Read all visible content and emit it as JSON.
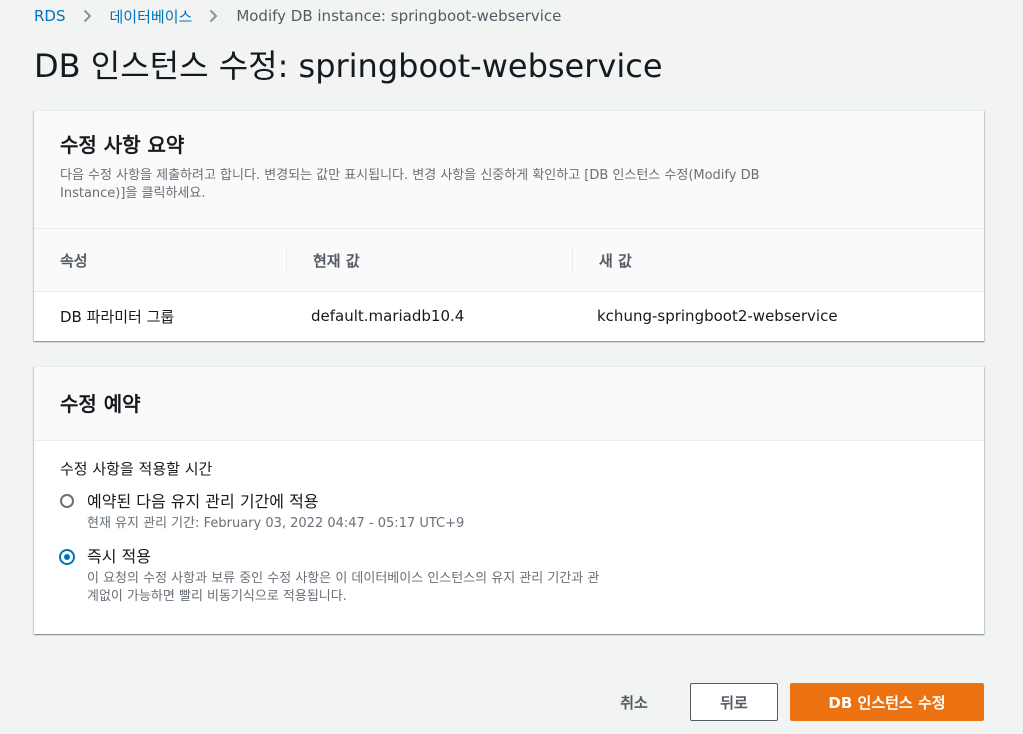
{
  "breadcrumb": {
    "items": [
      "RDS",
      "데이터베이스"
    ],
    "current": "Modify DB instance: springboot-webservice"
  },
  "page": {
    "title": "DB 인스턴스 수정: springboot-webservice"
  },
  "summary": {
    "title": "수정 사항 요약",
    "description_line1": "다음 수정 사항을 제출하려고 합니다. 변경되는 값만 표시됩니다. 변경 사항을 신중하게 확인하고 [DB 인스턴스 수정(Modify DB",
    "description_line2": "Instance)]을 클릭하세요.",
    "columns": [
      "속성",
      "현재 값",
      "새 값"
    ],
    "rows": [
      [
        "DB 파라미터 그룹",
        "default.mariadb10.4",
        "kchung-springboot2-webservice"
      ]
    ]
  },
  "schedule": {
    "title": "수정 예약",
    "group_label": "수정 사항을 적용할 시간",
    "options": [
      {
        "label": "예약된 다음 유지 관리 기간에 적용",
        "description_line1": "현재 유지 관리 기간: February 03, 2022 04:47 - 05:17 UTC+9",
        "description_line2": "",
        "selected": false
      },
      {
        "label": "즉시 적용",
        "description_line1": "이 요청의 수정 사항과 보류 중인 수정 사항은 이 데이터베이스 인스턴스의 유지 관리 기간과 관",
        "description_line2": "계없이 가능하면 빨리 비동기식으로 적용됩니다.",
        "selected": true
      }
    ]
  },
  "actions": {
    "cancel": "취소",
    "back": "뒤로",
    "submit": "DB 인스턴스 수정"
  },
  "colors": {
    "link": "#0073bb",
    "primary_button": "#ec7211",
    "radio_selected": "#0073bb"
  },
  "icons": {
    "breadcrumb_separator": "chevron-right-icon"
  }
}
